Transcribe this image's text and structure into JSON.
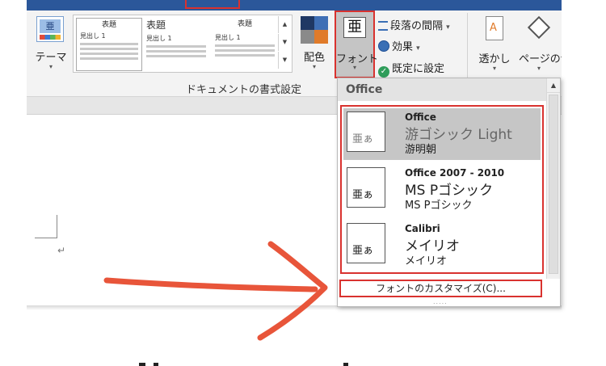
{
  "ribbon": {
    "theme_label": "テーマ",
    "gallery_thumbs": [
      {
        "title": "表題",
        "heading": "見出し 1"
      },
      {
        "title": "表題",
        "heading": "見出し 1"
      },
      {
        "title": "表題",
        "heading": "見出し 1"
      }
    ],
    "colors_label": "配色",
    "fonts_label": "フォント",
    "fonts_icon_glyph": "亜",
    "spacing_label": "段落の間隔",
    "effects_label": "効果",
    "set_default_label": "既定に設定",
    "watermark_label": "透かし",
    "page_color_label": "ページの色",
    "group_label": "ドキュメントの書式設定",
    "caret": "▾"
  },
  "dropdown": {
    "header": "Office",
    "fonts": [
      {
        "name": "Office",
        "heading_font": "游ゴシック Light",
        "body_font": "游明朝",
        "preview": "亜ぁ",
        "selected": true
      },
      {
        "name": "Office 2007 - 2010",
        "heading_font": "MS Pゴシック",
        "body_font": "MS Pゴシック",
        "preview": "亜ぁ",
        "selected": false
      },
      {
        "name": "Calibri",
        "heading_font": "メイリオ",
        "body_font": "メイリオ",
        "preview": "亜ぁ",
        "selected": false
      }
    ],
    "customize_label": "フォントのカスタマイズ(C)...",
    "grip": "....."
  },
  "document": {
    "paragraph_mark": "↵"
  },
  "colors": {
    "highlight_red": "#d9322f",
    "title_bar_blue": "#2b579a",
    "arrow_orange": "#e8553a"
  }
}
